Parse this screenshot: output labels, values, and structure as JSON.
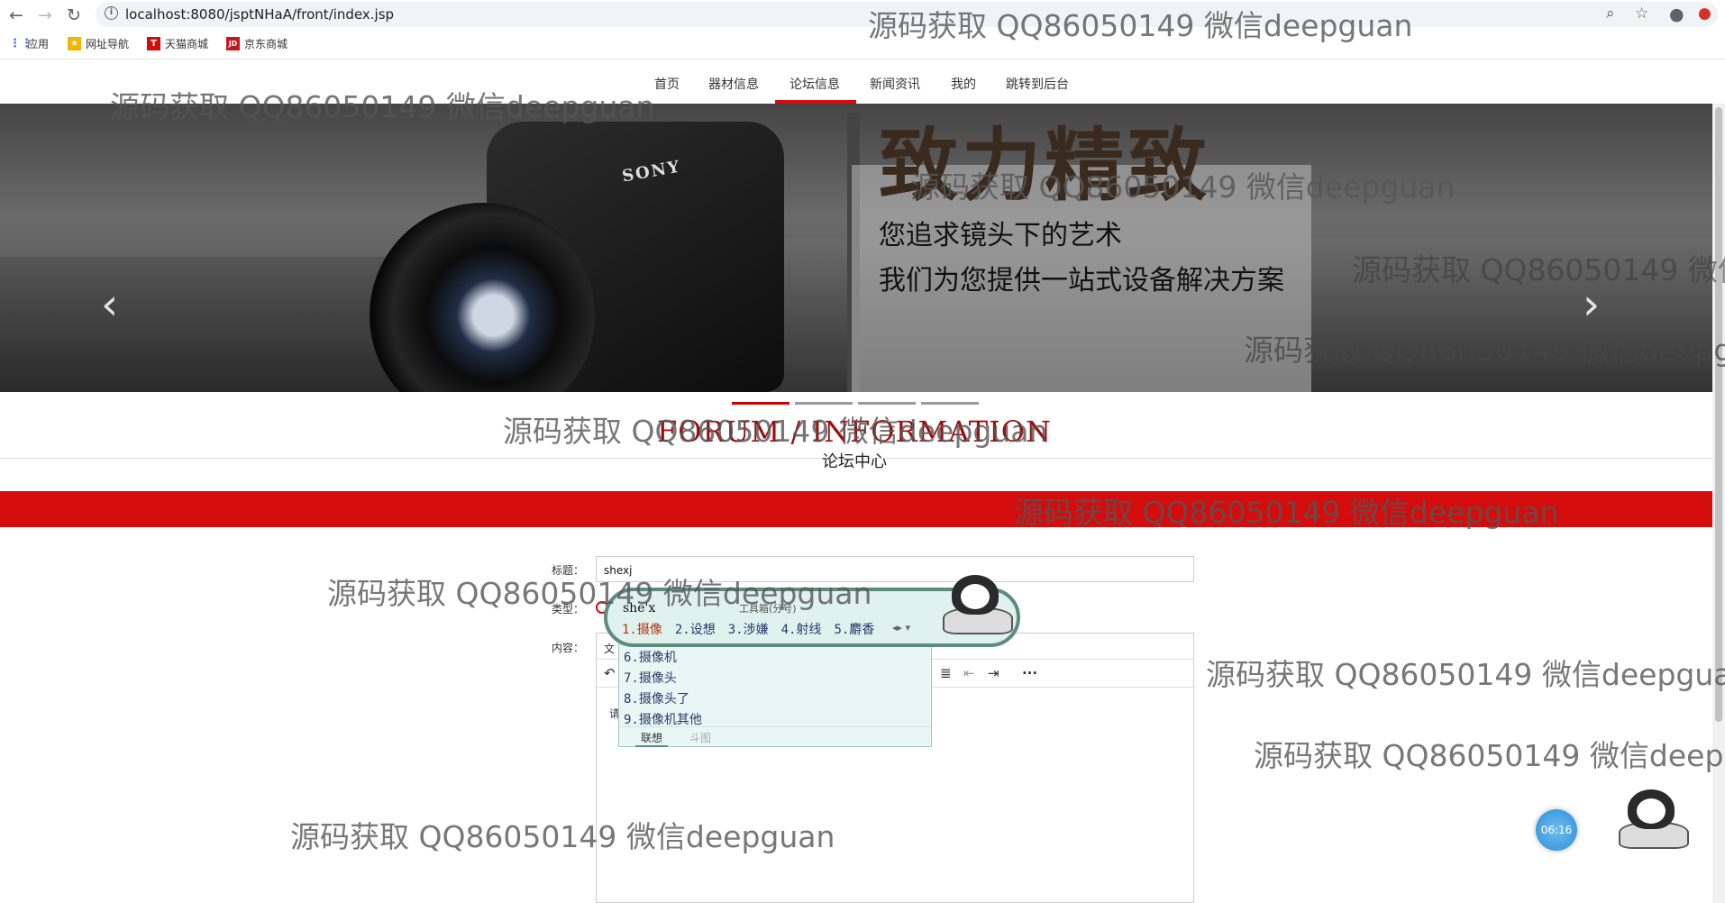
{
  "browser": {
    "url": "localhost:8080/jsptNHaA/front/index.jsp",
    "bookmarks": [
      {
        "label": "应用",
        "icon": "apps-grid-icon"
      },
      {
        "label": "网址导航",
        "icon": "star-folder-icon"
      },
      {
        "label": "天猫商城",
        "icon": "tmall-icon"
      },
      {
        "label": "京东商城",
        "icon": "jd-icon"
      }
    ],
    "icons": [
      "back-icon",
      "forward-icon",
      "reload-icon",
      "zoom-icon",
      "bookmark-star-icon",
      "account-icon",
      "extension-icon"
    ]
  },
  "nav": {
    "items": [
      "首页",
      "器材信息",
      "论坛信息",
      "新闻资讯",
      "我的",
      "跳转到后台"
    ],
    "active": "论坛信息"
  },
  "banner": {
    "brand": "SONY",
    "headline": "致力精致",
    "line1": "您追求镜头下的艺术",
    "line2": "我们为您提供一站式设备解决方案",
    "prev_arrow": "‹",
    "next_arrow": "›"
  },
  "section": {
    "title_en": "FORUM / INFORMATION",
    "title_cn": "论坛中心"
  },
  "form": {
    "title_label": "标题：",
    "title_value": "shexj",
    "type_label": "类型：",
    "content_label": "内容：",
    "editor_tab": "文",
    "editor_placeholder": "请"
  },
  "ime": {
    "pinyin": "she'x",
    "toolbox": "工具箱(分号)",
    "row1": [
      "1.摄像",
      "2.设想",
      "3.涉嫌",
      "4.射线",
      "5.麝香"
    ],
    "more": [
      "6.摄像机",
      "7.摄像头",
      "8.摄像头了",
      "9.摄像机其他"
    ],
    "tab_on": "联想",
    "tab_off": "斗图"
  },
  "widget": {
    "timer": "06:16"
  },
  "watermark": "源码获取 QQ86050149 微信deepguan"
}
